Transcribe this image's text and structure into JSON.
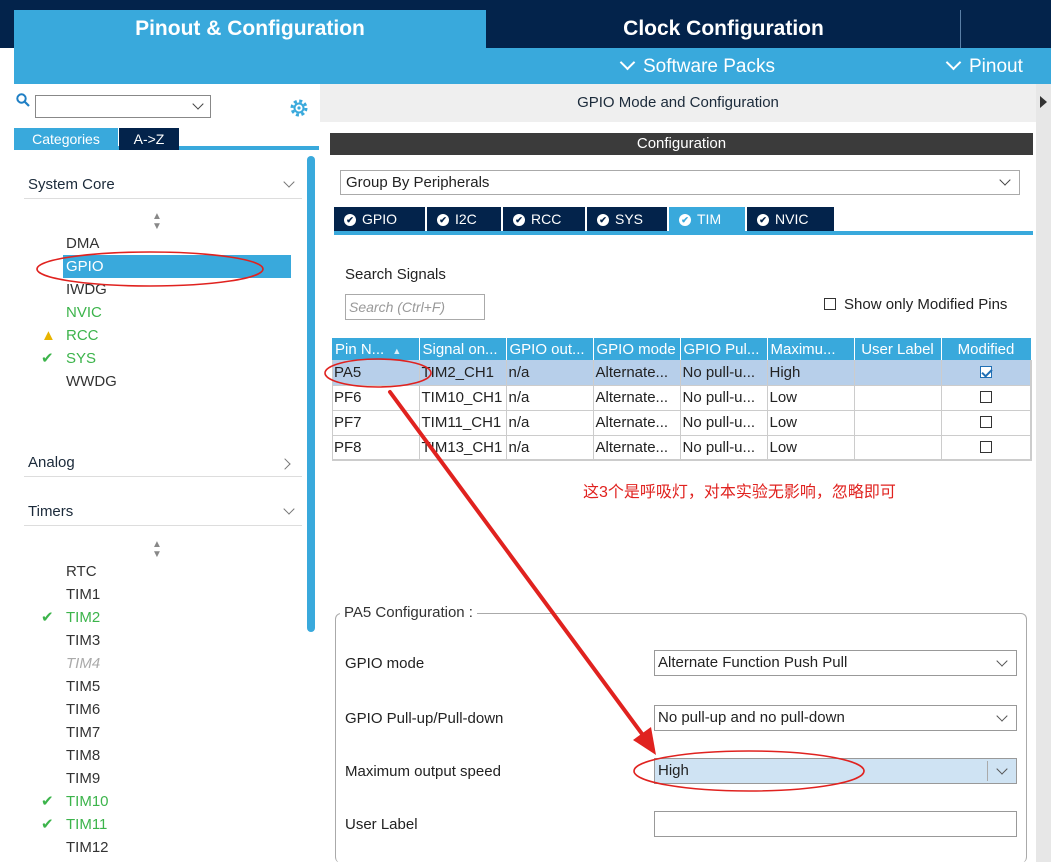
{
  "header": {
    "tab_pinout": "Pinout & Configuration",
    "tab_clock": "Clock Configuration",
    "software_packs": "Software Packs",
    "pinout_menu": "Pinout"
  },
  "sidebar": {
    "tab_categories": "Categories",
    "tab_az": "A->Z",
    "sections": [
      {
        "label": "System Core"
      },
      {
        "label": "Analog"
      },
      {
        "label": "Timers"
      }
    ],
    "system_core_items": [
      "DMA",
      "GPIO",
      "IWDG",
      "NVIC",
      "RCC",
      "SYS",
      "WWDG"
    ],
    "timers_items": [
      "RTC",
      "TIM1",
      "TIM2",
      "TIM3",
      "TIM4",
      "TIM5",
      "TIM6",
      "TIM7",
      "TIM8",
      "TIM9",
      "TIM10",
      "TIM11",
      "TIM12"
    ],
    "colors": {
      "accent": "#39a9dc",
      "dark": "#03234b",
      "ok": "#3cb44b",
      "warn": "#e8b400"
    }
  },
  "main": {
    "mode_header": "GPIO Mode and Configuration",
    "config_bar": "Configuration",
    "group_by": "Group By Peripherals",
    "peripheral_tabs": [
      "GPIO",
      "I2C",
      "RCC",
      "SYS",
      "TIM",
      "NVIC"
    ],
    "active_tab": "TIM",
    "search_label": "Search Signals",
    "search_placeholder": "Search (Ctrl+F)",
    "show_modified": "Show only Modified Pins",
    "table": {
      "headers": [
        "Pin N...",
        "Signal on...",
        "GPIO out...",
        "GPIO mode",
        "GPIO Pul...",
        "Maximu...",
        "User Label",
        "Modified"
      ],
      "rows": [
        {
          "pin": "PA5",
          "signal": "TIM2_CH1",
          "out": "n/a",
          "mode": "Alternate...",
          "pull": "No pull-u...",
          "speed": "High",
          "label": "",
          "modified": true
        },
        {
          "pin": "PF6",
          "signal": "TIM10_CH1",
          "out": "n/a",
          "mode": "Alternate...",
          "pull": "No pull-u...",
          "speed": "Low",
          "label": "",
          "modified": false
        },
        {
          "pin": "PF7",
          "signal": "TIM11_CH1",
          "out": "n/a",
          "mode": "Alternate...",
          "pull": "No pull-u...",
          "speed": "Low",
          "label": "",
          "modified": false
        },
        {
          "pin": "PF8",
          "signal": "TIM13_CH1",
          "out": "n/a",
          "mode": "Alternate...",
          "pull": "No pull-u...",
          "speed": "Low",
          "label": "",
          "modified": false
        }
      ]
    },
    "annotation": "这3个是呼吸灯，对本实验无影响，忽略即可",
    "pa5": {
      "title": "PA5 Configuration :",
      "gpio_mode_label": "GPIO mode",
      "gpio_mode_value": "Alternate Function Push Pull",
      "pull_label": "GPIO Pull-up/Pull-down",
      "pull_value": "No pull-up and no pull-down",
      "speed_label": "Maximum output speed",
      "speed_value": "High",
      "user_label_label": "User Label",
      "user_label_value": ""
    }
  }
}
